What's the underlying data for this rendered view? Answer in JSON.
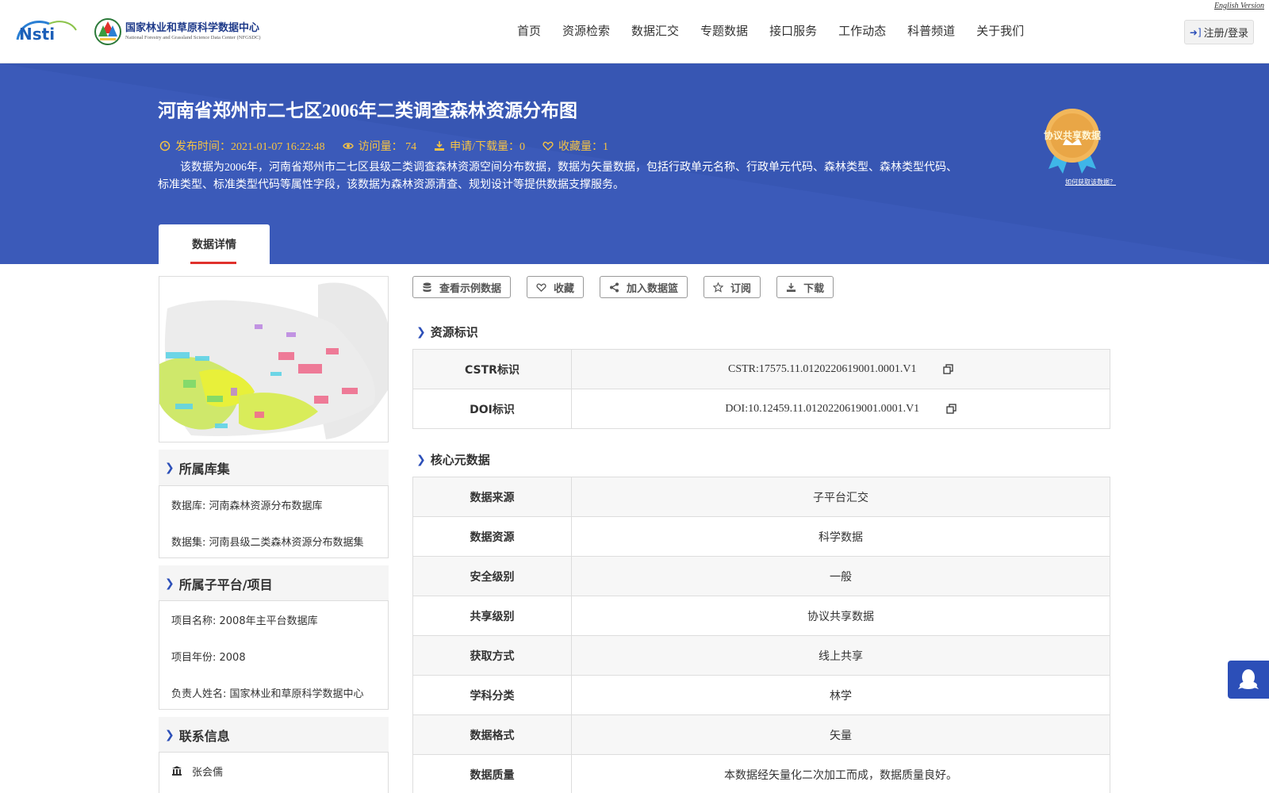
{
  "header": {
    "english_link": "English Version",
    "logo_nsti": "Nsti",
    "center_name_cn": "国家林业和草原科学数据中心",
    "center_name_en": "National Forestry and Grassland Science Data Center (NFGSDC)",
    "nav": [
      "首页",
      "资源检索",
      "数据汇交",
      "专题数据",
      "接口服务",
      "工作动态",
      "科普频道",
      "关于我们"
    ],
    "login_label": "注册/登录"
  },
  "banner": {
    "title": "河南省郑州市二七区2006年二类调查森林资源分布图",
    "publish_time": "发布时间：2021-01-07 16:22:48",
    "visits": "访问量： 74",
    "downloads": "申请/下载量：0",
    "favorites": "收藏量：1",
    "description": "该数据为2006年，河南省郑州市二七区县级二类调查森林资源空间分布数据，数据为矢量数据，包括行政单元名称、行政单元代码、森林类型、森林类型代码、标准类型、标准类型代码等属性字段，该数据为森林资源清查、规划设计等提供数据支撑服务。",
    "badge_text": "协议共享数据",
    "how_to_get": "如何获取该数据？",
    "tab_label": "数据详情"
  },
  "left": {
    "library_title": "所属库集",
    "library_items": [
      "数据库: 河南森林资源分布数据库",
      "数据集: 河南县级二类森林资源分布数据集"
    ],
    "project_title": "所属子平台/项目",
    "project_items": [
      "项目名称: 2008年主平台数据库",
      "项目年份: 2008",
      "负责人姓名: 国家林业和草原科学数据中心"
    ],
    "contact_title": "联系信息",
    "contact_name": "张会儒"
  },
  "actions": {
    "sample": "查看示例数据",
    "favorite": "收藏",
    "basket": "加入数据篮",
    "subscribe": "订阅",
    "download": "下载"
  },
  "resource_id": {
    "title": "资源标识",
    "rows": [
      {
        "key": "CSTR标识",
        "value": "CSTR:17575.11.0120220619001.0001.V1"
      },
      {
        "key": "DOI标识",
        "value": "DOI:10.12459.11.0120220619001.0001.V1"
      }
    ]
  },
  "core_meta": {
    "title": "核心元数据",
    "rows": [
      {
        "key": "数据来源",
        "value": "子平台汇交"
      },
      {
        "key": "数据资源",
        "value": "科学数据"
      },
      {
        "key": "安全级别",
        "value": "一般"
      },
      {
        "key": "共享级别",
        "value": "协议共享数据"
      },
      {
        "key": "获取方式",
        "value": "线上共享"
      },
      {
        "key": "学科分类",
        "value": "林学"
      },
      {
        "key": "数据格式",
        "value": "矢量"
      },
      {
        "key": "数据质量",
        "value": "本数据经矢量化二次加工而成，数据质量良好。"
      }
    ]
  },
  "colors": {
    "banner": "#3b5ab9",
    "accent_blue": "#2c4fb8",
    "meta_gold": "#f6c343",
    "tab_underline": "#e0312c"
  },
  "icons": [
    "clock-icon",
    "eye-icon",
    "download-icon",
    "heart-icon",
    "database-icon",
    "share-icon",
    "star-icon",
    "copy-icon",
    "bank-icon",
    "qq-icon",
    "login-icon"
  ]
}
